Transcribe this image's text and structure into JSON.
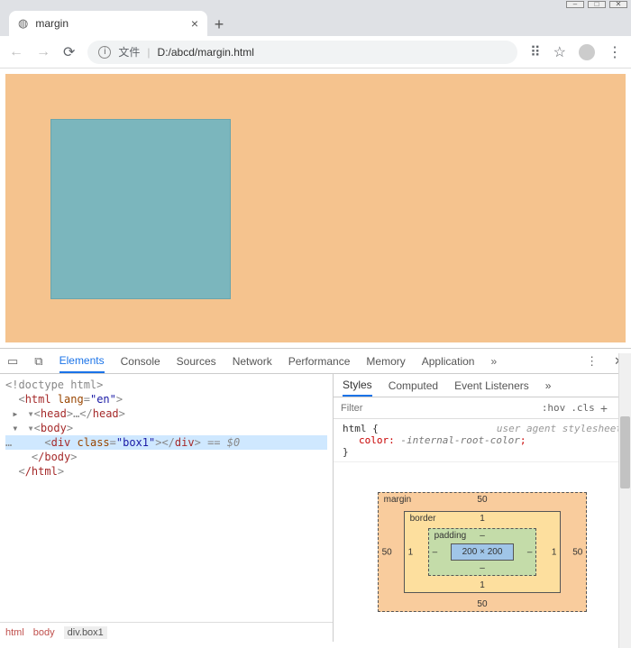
{
  "window": {
    "min": "–",
    "max": "□",
    "close": "✕"
  },
  "tab": {
    "title": "margin",
    "close": "×"
  },
  "newtab_label": "+",
  "nav": {
    "back": "←",
    "forward": "→",
    "reload": "⟳"
  },
  "omnibox": {
    "info": "i",
    "file_label": "文件",
    "sep": "|",
    "url": "D:/abcd/margin.html"
  },
  "toolbar_icons": {
    "translate": "⠿",
    "star": "☆",
    "menu": "⋮"
  },
  "devtools": {
    "tabs": [
      "Elements",
      "Console",
      "Sources",
      "Network",
      "Performance",
      "Memory",
      "Application"
    ],
    "more": "»",
    "menu": "⋮",
    "close": "✕",
    "inspect": "▭",
    "device": "⧉"
  },
  "dom": {
    "doctype": "<!doctype html>",
    "html_open_a": "html",
    "html_lang_attr": "lang",
    "html_lang_val": "\"en\"",
    "head_open": "head",
    "head_ellipsis": "…",
    "body": "body",
    "div_tag": "div",
    "div_class_attr": "class",
    "div_class_val": "\"box1\"",
    "eq0": " == $0",
    "close_body": "/body",
    "close_html": "/html"
  },
  "breadcrumb": {
    "a": "html",
    "b": "body",
    "c": "div.box1"
  },
  "styles": {
    "tabs": [
      "Styles",
      "Computed",
      "Event Listeners"
    ],
    "more": "»",
    "filter_placeholder": "Filter",
    "hov": ":hov",
    "cls": ".cls",
    "plus": "+",
    "rule_selector": "html {",
    "ua_label": "user agent stylesheet",
    "prop_name": "color",
    "prop_value": "-internal-root-color",
    "rule_close": "}"
  },
  "boxmodel": {
    "margin_label": "margin",
    "margin_top": "50",
    "margin_right": "50",
    "margin_bottom": "50",
    "margin_left": "50",
    "border_label": "border",
    "border_top": "1",
    "border_right": "1",
    "border_bottom": "1",
    "border_left": "1",
    "padding_label": "padding",
    "padding_top": "–",
    "padding_right": "–",
    "padding_bottom": "–",
    "padding_left": "–",
    "content": "200 × 200"
  }
}
